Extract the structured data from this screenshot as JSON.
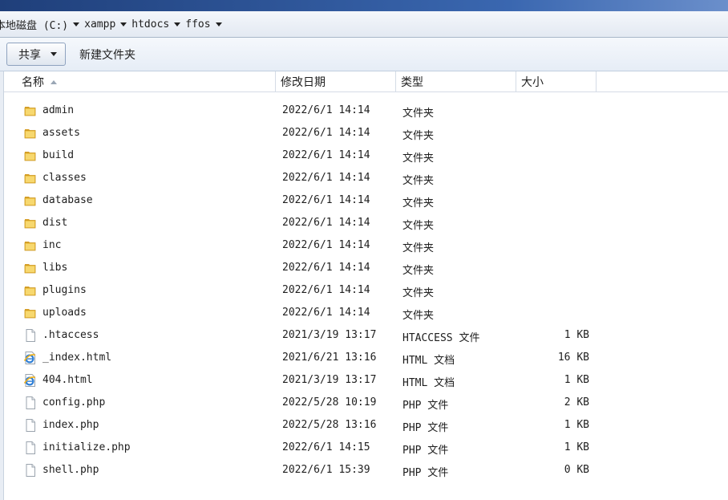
{
  "breadcrumb": [
    {
      "label": "本地磁盘 (C:)"
    },
    {
      "label": "xampp"
    },
    {
      "label": "htdocs"
    },
    {
      "label": "ffos"
    }
  ],
  "toolbar": {
    "share_label": "共享",
    "new_folder_label": "新建文件夹"
  },
  "columns": {
    "name": "名称",
    "date": "修改日期",
    "type": "类型",
    "size": "大小"
  },
  "files": [
    {
      "name": "admin",
      "date": "2022/6/1 14:14",
      "type": "文件夹",
      "size": "",
      "icon": "folder-icon"
    },
    {
      "name": "assets",
      "date": "2022/6/1 14:14",
      "type": "文件夹",
      "size": "",
      "icon": "folder-icon"
    },
    {
      "name": "build",
      "date": "2022/6/1 14:14",
      "type": "文件夹",
      "size": "",
      "icon": "folder-icon"
    },
    {
      "name": "classes",
      "date": "2022/6/1 14:14",
      "type": "文件夹",
      "size": "",
      "icon": "folder-icon"
    },
    {
      "name": "database",
      "date": "2022/6/1 14:14",
      "type": "文件夹",
      "size": "",
      "icon": "folder-icon"
    },
    {
      "name": "dist",
      "date": "2022/6/1 14:14",
      "type": "文件夹",
      "size": "",
      "icon": "folder-icon"
    },
    {
      "name": "inc",
      "date": "2022/6/1 14:14",
      "type": "文件夹",
      "size": "",
      "icon": "folder-icon"
    },
    {
      "name": "libs",
      "date": "2022/6/1 14:14",
      "type": "文件夹",
      "size": "",
      "icon": "folder-icon"
    },
    {
      "name": "plugins",
      "date": "2022/6/1 14:14",
      "type": "文件夹",
      "size": "",
      "icon": "folder-icon"
    },
    {
      "name": "uploads",
      "date": "2022/6/1 14:14",
      "type": "文件夹",
      "size": "",
      "icon": "folder-icon"
    },
    {
      "name": ".htaccess",
      "date": "2021/3/19 13:17",
      "type": "HTACCESS 文件",
      "size": "1 KB",
      "icon": "file-icon"
    },
    {
      "name": "_index.html",
      "date": "2021/6/21 13:16",
      "type": "HTML 文档",
      "size": "16 KB",
      "icon": "ie-html-icon"
    },
    {
      "name": "404.html",
      "date": "2021/3/19 13:17",
      "type": "HTML 文档",
      "size": "1 KB",
      "icon": "ie-html-icon"
    },
    {
      "name": "config.php",
      "date": "2022/5/28 10:19",
      "type": "PHP 文件",
      "size": "2 KB",
      "icon": "file-icon"
    },
    {
      "name": "index.php",
      "date": "2022/5/28 13:16",
      "type": "PHP 文件",
      "size": "1 KB",
      "icon": "file-icon"
    },
    {
      "name": "initialize.php",
      "date": "2022/6/1 14:15",
      "type": "PHP 文件",
      "size": "1 KB",
      "icon": "file-icon"
    },
    {
      "name": "shell.php",
      "date": "2022/6/1 15:39",
      "type": "PHP 文件",
      "size": "0 KB",
      "icon": "file-icon"
    }
  ],
  "colors": {
    "titlebar": "#3a67b0",
    "folder": "#e8b83a"
  }
}
